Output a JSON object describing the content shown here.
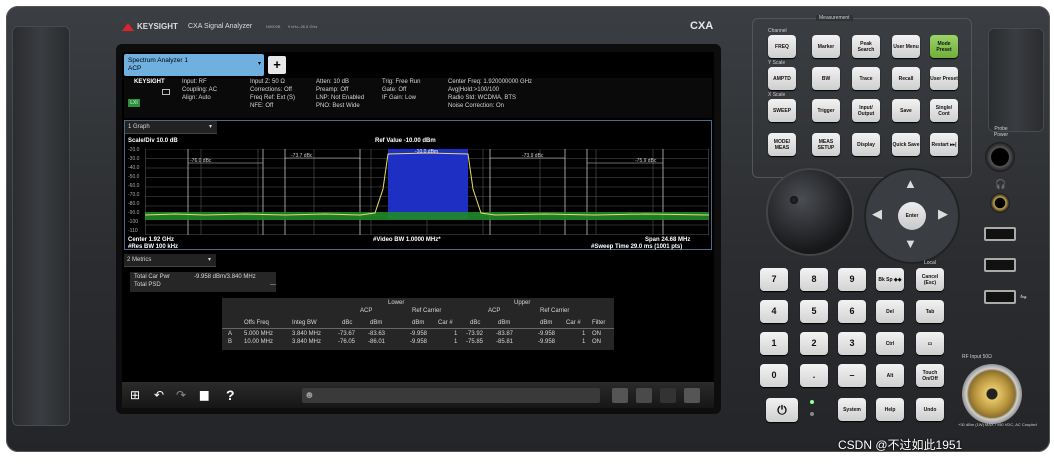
{
  "front_panel": {
    "brand": "KEYSIGHT",
    "instrument_title": "CXA Signal Analyzer",
    "model": "N9000B",
    "freq_range": "9 kHz–26.5 GHz",
    "series": "CXA"
  },
  "tab": {
    "title": "Spectrum Analyzer 1",
    "mode": "ACP",
    "add_symbol": "+"
  },
  "settings": {
    "logo": "KEYSIGHT",
    "lxi": "LXI",
    "col1": [
      "Input: RF",
      "Coupling: AC",
      "Align: Auto"
    ],
    "col2": [
      "Input Z: 50 Ω",
      "Corrections: Off",
      "Freq Ref: Ext (S)",
      "NFE: Off"
    ],
    "col3": [
      "Atten: 10 dB",
      "Preamp: Off",
      "LNP: Not Enabled",
      "PNO: Best Wide"
    ],
    "col4": [
      "Trig: Free Run",
      "Gate: Off",
      "IF Gain: Low"
    ],
    "col5": [
      "Center Freq: 1.920000000 GHz",
      "Avg|Hold:>100/100",
      "Radio Std: WCDMA, BTS",
      "Noise Correction: On"
    ]
  },
  "graph": {
    "window_label": "1 Graph",
    "scale": "Scale/Div 10.0 dB",
    "ref_value": "Ref Value -10.00 dBm",
    "y_ticks": [
      "-20.0",
      "-30.0",
      "-40.0",
      "-50.0",
      "-60.0",
      "-70.0",
      "-80.0",
      "-90.0",
      "-100",
      "-110"
    ],
    "channel_labels": [
      "-76.0 dBc",
      "-73.7 dBc",
      "-10.0 dBm",
      "-73.9 dBc",
      "-75.9 dBc"
    ],
    "center": "Center 1.92 GHz",
    "res_bw": "#Res BW 100 kHz",
    "video_bw": "#Video BW 1.0000 MHz*",
    "span": "Span 24.68 MHz",
    "sweep": "#Sweep Time 29.0 ms (1001 pts)"
  },
  "metrics": {
    "window_label": "2 Metrics",
    "total_car_pwr_label": "Total Car Pwr",
    "total_car_pwr_value": "-9.958 dBm/3.840 MHz",
    "total_psd_label": "Total PSD",
    "total_psd_value": "---",
    "lower_header": "Lower",
    "upper_header": "Upper",
    "acp_header": "ACP",
    "ref_carrier_header": "Ref Carrier",
    "columns": [
      "Offs Freq",
      "Integ BW",
      "dBc",
      "dBm",
      "dBm",
      "Car #",
      "dBc",
      "dBm",
      "dBm",
      "Car #",
      "Filter"
    ],
    "rows": [
      [
        "A",
        "5.000 MHz",
        "3.840 MHz",
        "-73.67",
        "-83.63",
        "-9.958",
        "1",
        "-73.92",
        "-83.87",
        "-9.958",
        "1",
        "ON"
      ],
      [
        "B",
        "10.00 MHz",
        "3.840 MHz",
        "-76.05",
        "-86.01",
        "-9.958",
        "1",
        "-75.85",
        "-85.81",
        "-9.958",
        "1",
        "ON"
      ]
    ]
  },
  "taskbar": {
    "windows": "⊞",
    "undo": "↶",
    "redo": "↷",
    "folder": "▆",
    "help": "?",
    "chat": "☻"
  },
  "keys": {
    "measurement_group": "Measurement",
    "channel": "Channel",
    "freq": "FREQ",
    "marker": "Marker",
    "peak_search": "Peak Search",
    "user_menu": "User Menu",
    "mode_preset": "Mode Preset",
    "y_scale": "Y Scale",
    "amptd": "AMPTD",
    "bw": "BW",
    "trace": "Trace",
    "recall": "Recall",
    "user_preset": "User Preset",
    "x_scale": "X Scale",
    "sweep": "SWEEP",
    "trigger": "Trigger",
    "input_output": "Input/ Output",
    "save": "Save",
    "single_cont": "Single/ Cont",
    "mode_meas": "MODE/ MEAS",
    "meas_setup": "MEAS SETUP",
    "display": "Display",
    "quick_save": "Quick Save",
    "restart": "Restart ▸▸|",
    "numbers": [
      "7",
      "8",
      "9",
      "4",
      "5",
      "6",
      "1",
      "2",
      "3",
      "0",
      "."
    ],
    "bk_sp": "Bk Sp ◆◆",
    "cancel_esc": "Cancel (Esc)",
    "del": "Del",
    "tab": "Tab",
    "ctrl": "Ctrl",
    "alt": "Alt",
    "minus": "–",
    "touch_on_off": "Touch On/Off",
    "system": "System",
    "help": "Help",
    "undo": "Undo",
    "enter": "Enter",
    "local": "Local",
    "probe_power": "Probe Power",
    "rf_input": "RF Input 50Ω",
    "rf_warning": "+30 dBm (1W) MAX / ±50 VDC, AC Coupled"
  },
  "watermark": "CSDN @不过如此1951",
  "colors": {
    "trace_green": "#1f8a2a",
    "trace_yellow": "#e8d96a",
    "channel_blue": "#1e2fc4",
    "tab_blue": "#6fb0e0",
    "mode_preset_green": "#7fc04a"
  }
}
